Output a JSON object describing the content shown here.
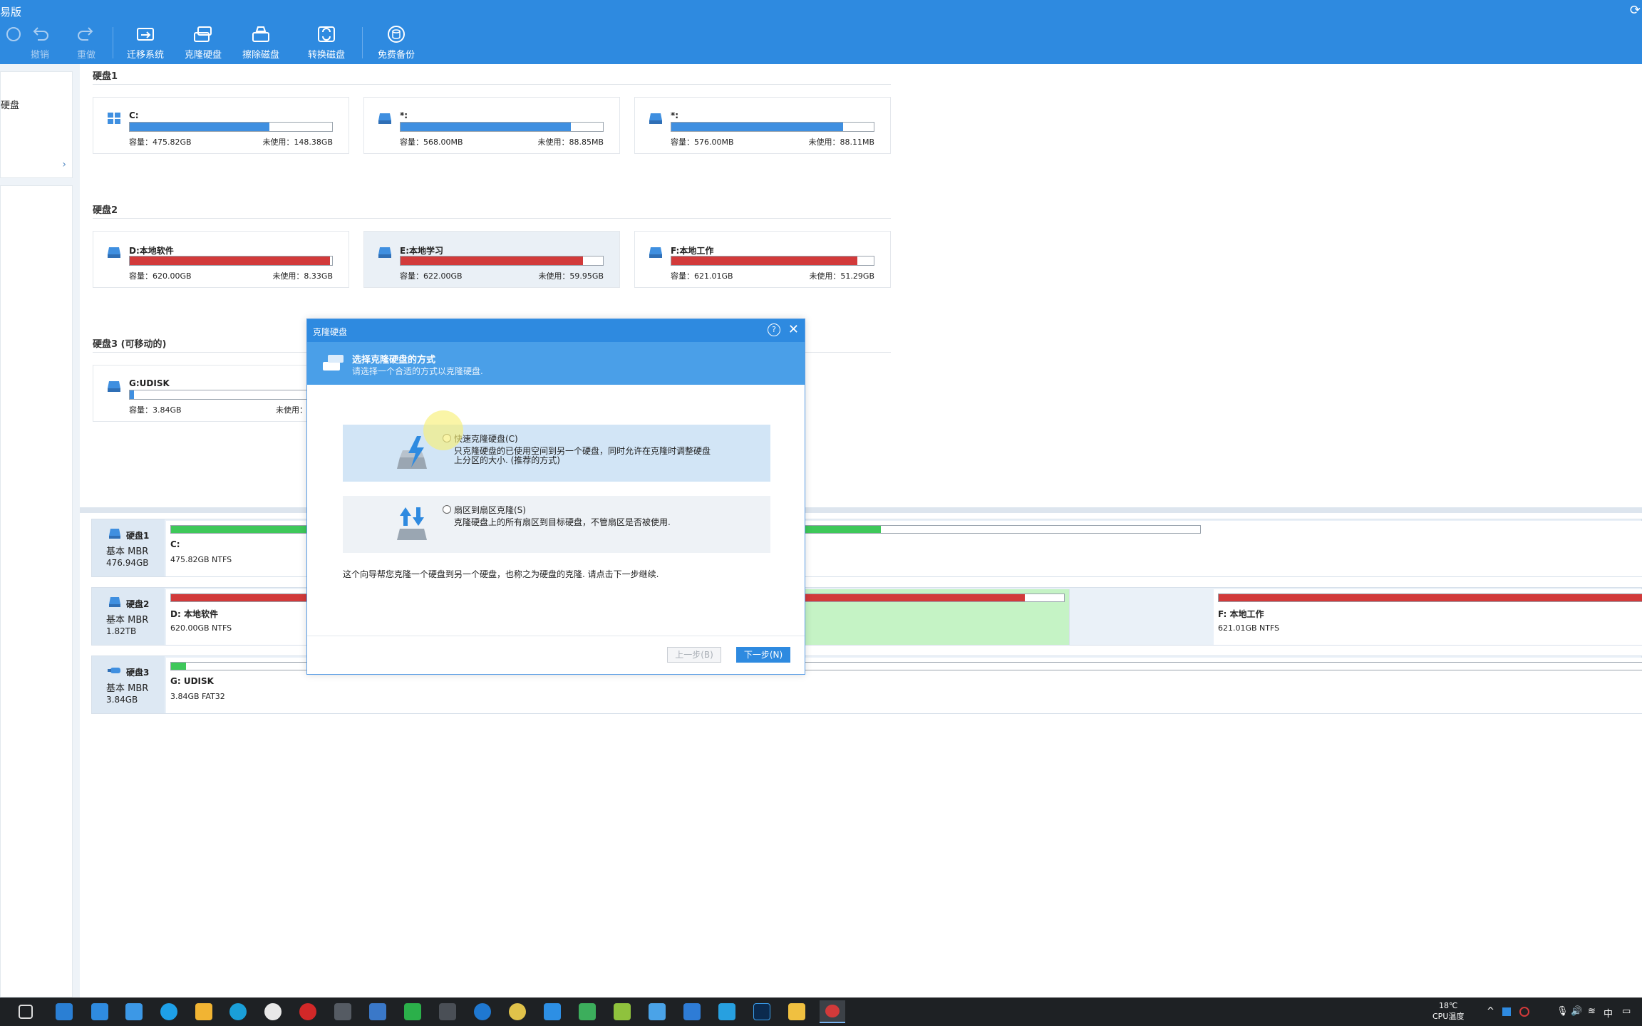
{
  "app": {
    "title": "易版"
  },
  "toolbar": {
    "items": [
      {
        "label": "撤销",
        "disabled": true,
        "icon": "undo-icon"
      },
      {
        "label": "重做",
        "disabled": true,
        "icon": "redo-icon"
      },
      {
        "label": "迁移系统",
        "icon": "migrate-os-icon"
      },
      {
        "label": "克隆硬盘",
        "icon": "clone-disk-icon"
      },
      {
        "label": "擦除磁盘",
        "icon": "wipe-disk-icon"
      },
      {
        "label": "转换磁盘",
        "icon": "convert-disk-icon"
      },
      {
        "label": "免费备份",
        "icon": "backup-icon"
      }
    ]
  },
  "sidebar": {
    "item_label": "硬盘",
    "chevron": "›"
  },
  "disks": [
    {
      "name": "硬盘1",
      "partitions": [
        {
          "name": "C:",
          "capacity": "容量：475.82GB",
          "free": "未使用：148.38GB",
          "used": 0.69,
          "color": "#3f8fe0",
          "icon": "windows-icon"
        },
        {
          "name": "*:",
          "capacity": "容量：568.00MB",
          "free": "未使用：88.85MB",
          "used": 0.84,
          "color": "#3f8fe0",
          "icon": "drive-icon"
        },
        {
          "name": "*:",
          "capacity": "容量：576.00MB",
          "free": "未使用：88.11MB",
          "used": 0.85,
          "color": "#3f8fe0",
          "icon": "drive-icon"
        }
      ]
    },
    {
      "name": "硬盘2",
      "partitions": [
        {
          "name": "D:本地软件",
          "capacity": "容量：620.00GB",
          "free": "未使用：8.33GB",
          "used": 0.99,
          "color": "#d23a3a",
          "icon": "drive-icon"
        },
        {
          "name": "E:本地学习",
          "capacity": "容量：622.00GB",
          "free": "未使用：59.95GB",
          "used": 0.9,
          "color": "#d23a3a",
          "icon": "drive-icon"
        },
        {
          "name": "F:本地工作",
          "capacity": "容量：621.01GB",
          "free": "未使用：51.29GB",
          "used": 0.92,
          "color": "#d23a3a",
          "icon": "drive-icon"
        }
      ]
    },
    {
      "name": "硬盘3 (可移动的)",
      "partitions": [
        {
          "name": "G:UDISK",
          "capacity": "容量：3.84GB",
          "free": "未使用：",
          "used": 0.02,
          "color": "#3f8fe0",
          "icon": "drive-icon"
        }
      ]
    }
  ],
  "disk_map": [
    {
      "name": "硬盘1",
      "type": "基本 MBR",
      "size": "476.94GB",
      "segments": [
        {
          "name": "C:",
          "info": "475.82GB NTFS",
          "used": 0.69,
          "color": "#3ec85a"
        }
      ]
    },
    {
      "name": "硬盘2",
      "type": "基本 MBR",
      "size": "1.82TB",
      "segments": [
        {
          "name": "D: 本地软件",
          "info": "620.00GB NTFS",
          "used": 0.99,
          "color": "#d23a3a"
        },
        {
          "name": "",
          "info": "",
          "used": 0.9,
          "color": "#d23a3a"
        },
        {
          "name": "F: 本地工作",
          "info": "621.01GB NTFS",
          "used": 0.99,
          "color": "#d23a3a"
        }
      ]
    },
    {
      "name": "硬盘3",
      "type": "基本 MBR",
      "size": "3.84GB",
      "segments": [
        {
          "name": "G: UDISK",
          "info": "3.84GB FAT32",
          "used": 0.01,
          "color": "#3ec85a"
        }
      ]
    }
  ],
  "dialog": {
    "title": "克隆硬盘",
    "help": "?",
    "close": "✕",
    "header_title": "选择克隆硬盘的方式",
    "header_subtitle": "请选择一个合适的方式以克隆硬盘.",
    "option1": {
      "title": "快速克隆硬盘(C)",
      "desc": "只克隆硬盘的已使用空间到另一个硬盘，同时允许在克隆时调整硬盘上分区的大小. (推荐的方式)"
    },
    "option2": {
      "title": "扇区到扇区克隆(S)",
      "desc": "克隆硬盘上的所有扇区到目标硬盘，不管扇区是否被使用."
    },
    "note": "这个向导帮您克隆一个硬盘到另一个硬盘，也称之为硬盘的克隆. 请点击下一步继续.",
    "prev_label": "上一步(B)",
    "next_label": "下一步(N)"
  },
  "taskbar": {
    "temperature": "18℃",
    "temperature_label": "CPU温度",
    "ime": "中"
  }
}
